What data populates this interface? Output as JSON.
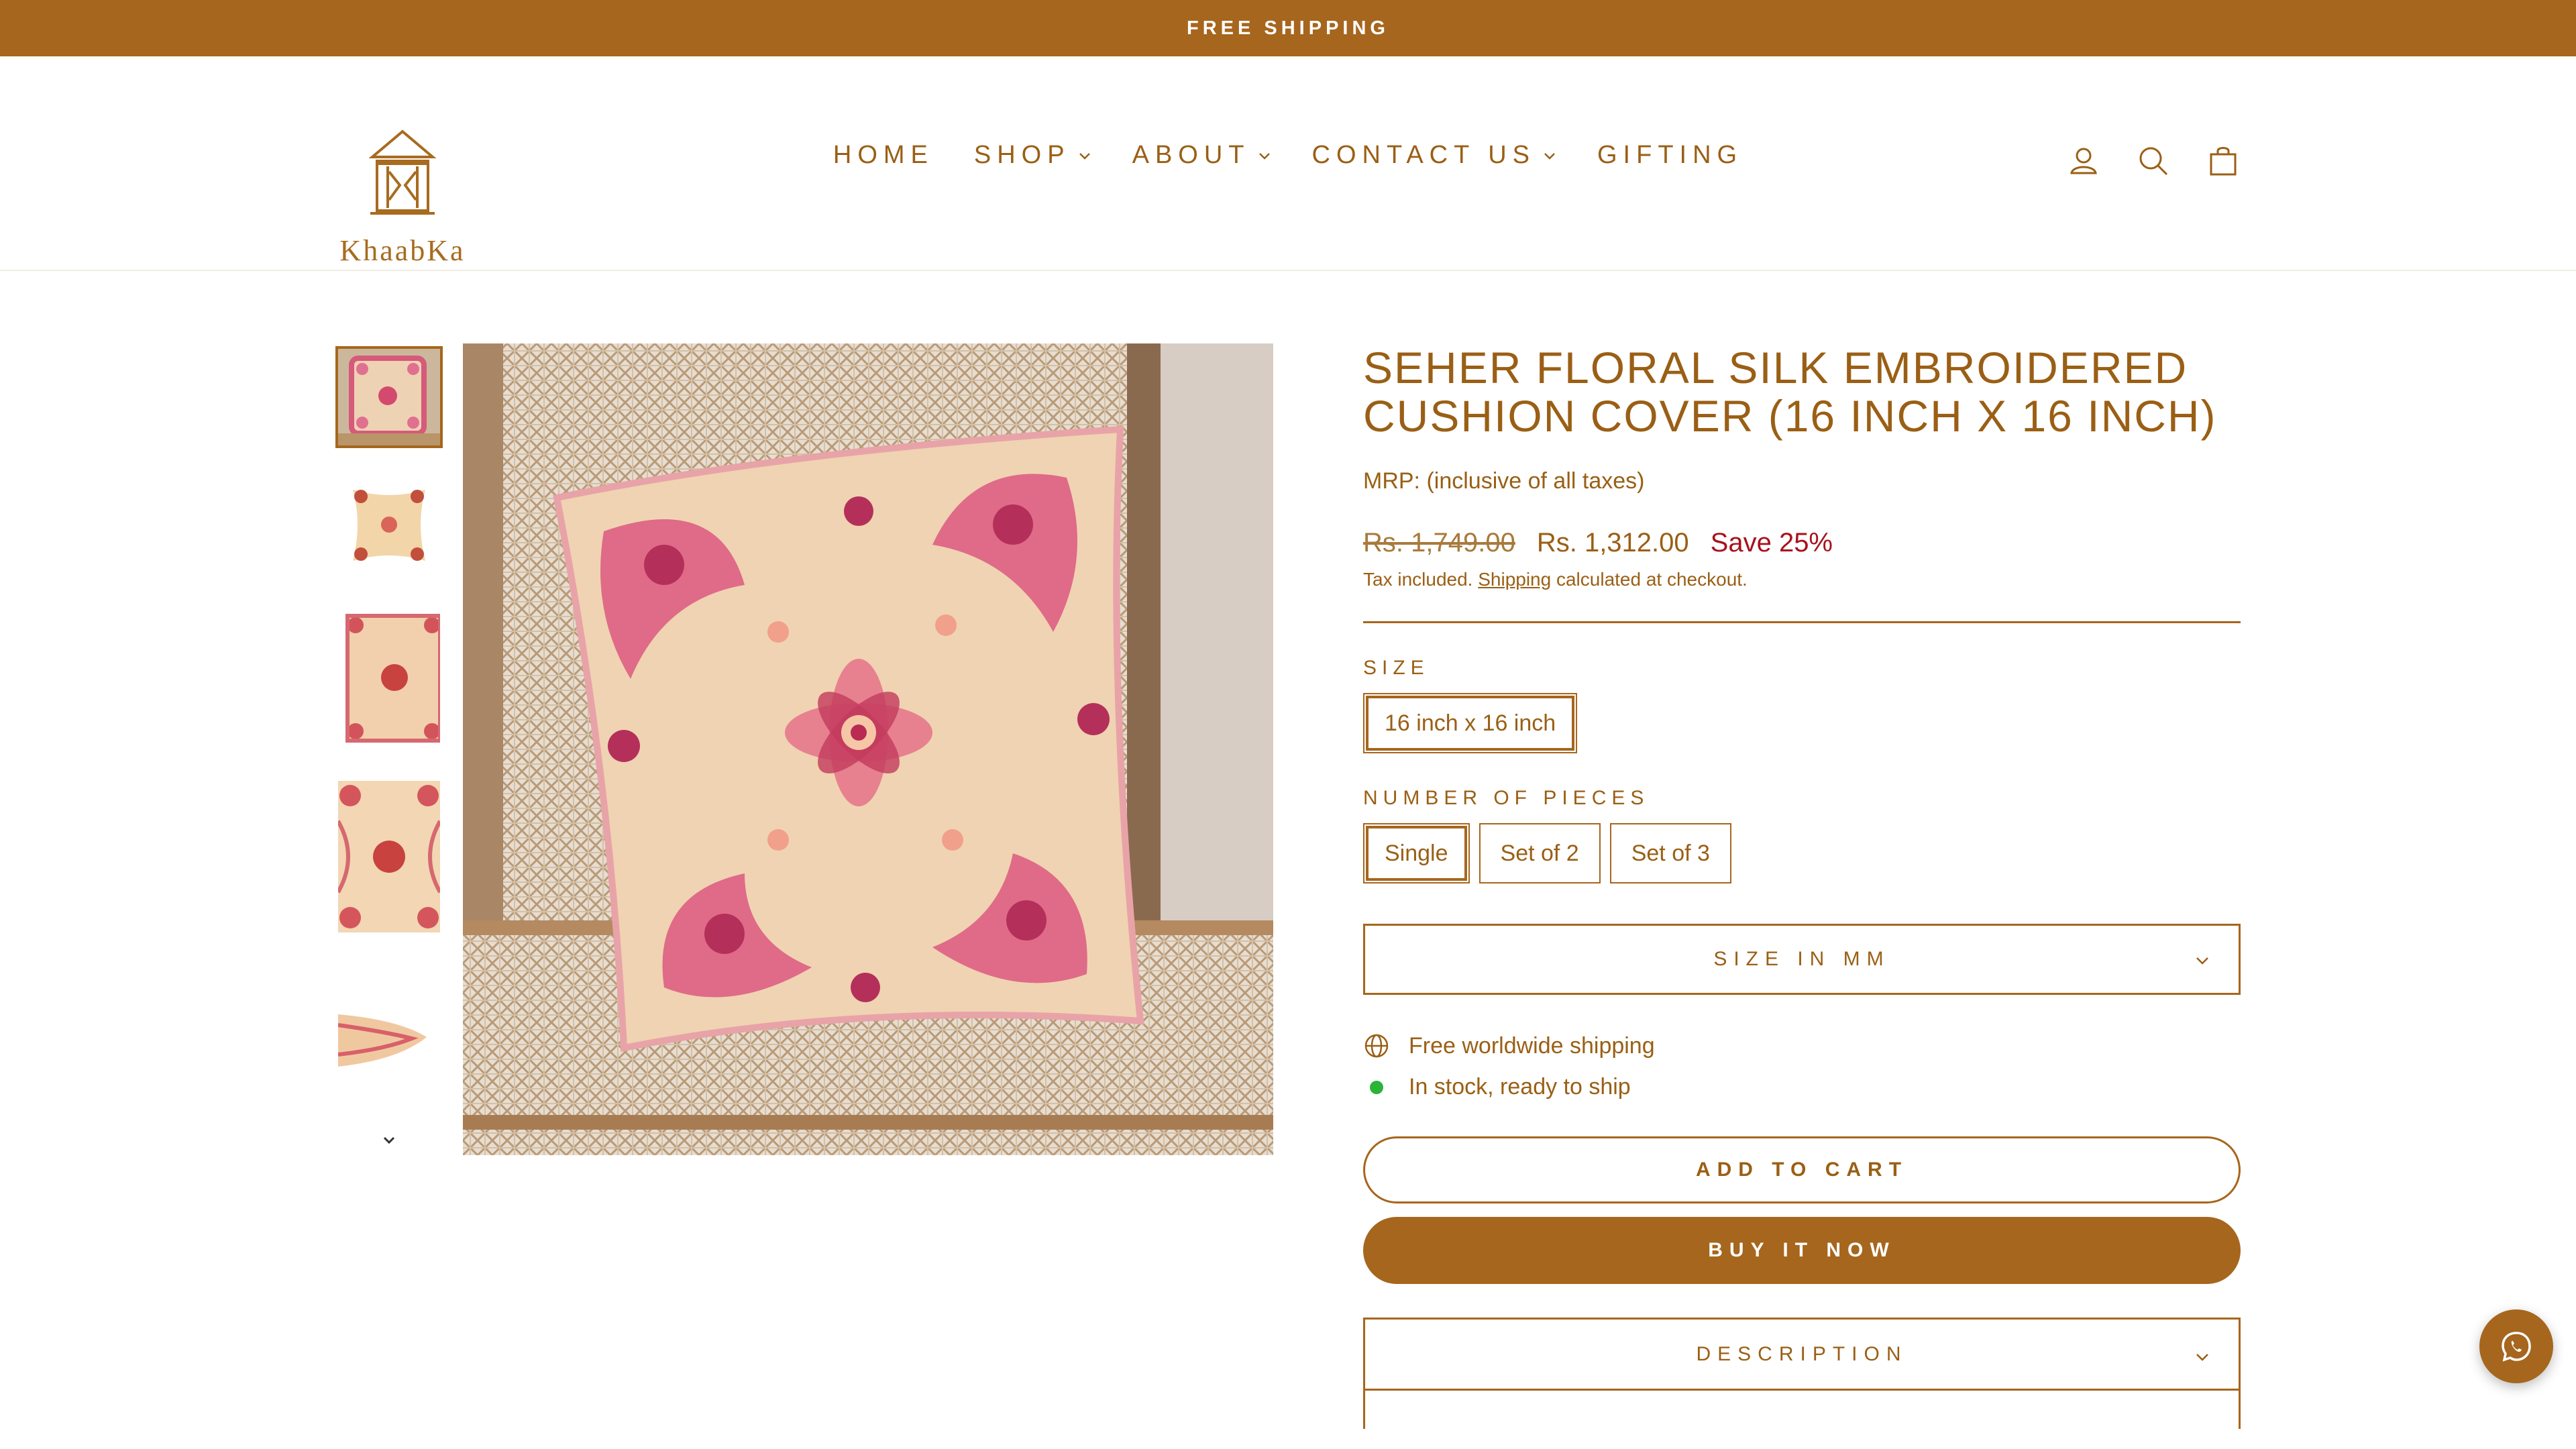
{
  "announcement": {
    "text": "FREE SHIPPING"
  },
  "brand": {
    "name": "KhaabKa"
  },
  "nav": {
    "items": [
      {
        "label": "HOME",
        "dropdown": false
      },
      {
        "label": "SHOP",
        "dropdown": true
      },
      {
        "label": "ABOUT",
        "dropdown": true
      },
      {
        "label": "CONTACT US",
        "dropdown": true
      },
      {
        "label": "GIFTING",
        "dropdown": false
      }
    ]
  },
  "header_icons": [
    "account-icon",
    "search-icon",
    "cart-icon"
  ],
  "product": {
    "title": "SEHER FLORAL SILK EMBROIDERED CUSHION COVER (16 INCH X 16 INCH)",
    "mrp_note": "MRP: (inclusive of all taxes)",
    "price_old": "Rs. 1,749.00",
    "price_new": "Rs. 1,312.00",
    "save": "Save 25%",
    "tax_prefix": "Tax included. ",
    "tax_link": "Shipping",
    "tax_suffix": " calculated at checkout.",
    "size_label": "SIZE",
    "size_options": [
      "16 inch x 16 inch"
    ],
    "size_selected": "16 inch x 16 inch",
    "pieces_label": "NUMBER OF PIECES",
    "pieces_options": [
      "Single",
      "Set of 2",
      "Set of 3"
    ],
    "pieces_selected": "Single",
    "size_mm_label": "SIZE IN MM",
    "feature_shipping": "Free worldwide shipping",
    "feature_stock": "In stock, ready to ship",
    "add_to_cart": "ADD TO CART",
    "buy_now": "BUY IT NOW",
    "description_label": "DESCRIPTION"
  },
  "colors": {
    "brand": "#a6661d",
    "sale": "#a8121e",
    "stock": "#2bb33a"
  }
}
